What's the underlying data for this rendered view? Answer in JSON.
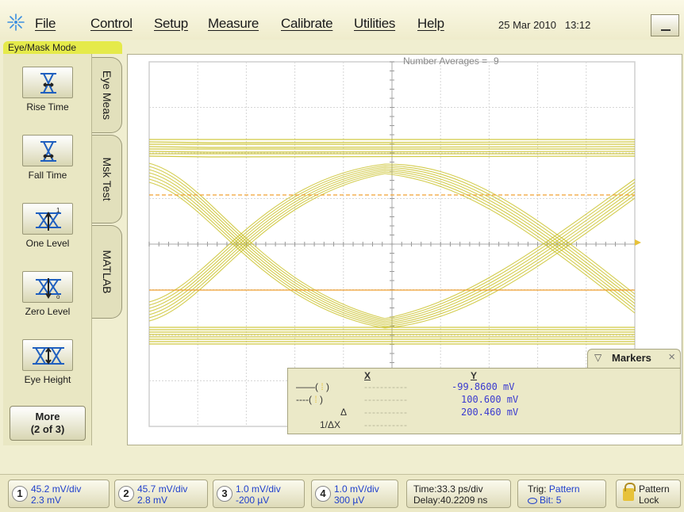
{
  "menu": {
    "items": [
      "File",
      "Control",
      "Setup",
      "Measure",
      "Calibrate",
      "Utilities",
      "Help"
    ],
    "date": "25 Mar 2010",
    "time": "13:12"
  },
  "mode_label": "Eye/Mask Mode",
  "tools": [
    {
      "label": "Rise Time",
      "icon": "rise-time-icon"
    },
    {
      "label": "Fall Time",
      "icon": "fall-time-icon"
    },
    {
      "label": "One Level",
      "icon": "one-level-icon"
    },
    {
      "label": "Zero Level",
      "icon": "zero-level-icon"
    },
    {
      "label": "Eye Height",
      "icon": "eye-height-icon"
    }
  ],
  "more_button": {
    "line1": "More",
    "line2": "(2 of 3)"
  },
  "tabs": [
    {
      "label": "Eye Meas",
      "active": true
    },
    {
      "label": "Msk Test",
      "active": false
    },
    {
      "label": "MATLAB",
      "active": false
    }
  ],
  "display": {
    "averages_label": "Number Averages =",
    "averages_value": "9",
    "trace_color": "#c8bf22",
    "marker_color": "#f0a030"
  },
  "markers": {
    "title": "Markers",
    "col_x": "X",
    "col_y": "Y",
    "rows": [
      {
        "y": "-99.8600 mV"
      },
      {
        "y": "100.600 mV"
      },
      {
        "symbol": "Δ",
        "y": "200.460 mV"
      },
      {
        "symbol": "1/ΔX",
        "y": ""
      }
    ]
  },
  "channels": [
    {
      "num": "1",
      "scale": "45.2 mV/div",
      "offset": "2.3 mV"
    },
    {
      "num": "2",
      "scale": "45.7 mV/div",
      "offset": "2.8 mV"
    },
    {
      "num": "3",
      "scale": "1.0 mV/div",
      "offset": "-200 µV"
    },
    {
      "num": "4",
      "scale": "1.0 mV/div",
      "offset": "300 µV"
    }
  ],
  "timebase": {
    "time": "Time:33.3 ps/div",
    "delay": "Delay:40.2209 ns"
  },
  "trigger": {
    "label": "Trig:",
    "source": "Pattern",
    "bit_label": "Bit:",
    "bit": "5"
  },
  "pattern_lock": {
    "line1": "Pattern",
    "line2": "Lock"
  }
}
